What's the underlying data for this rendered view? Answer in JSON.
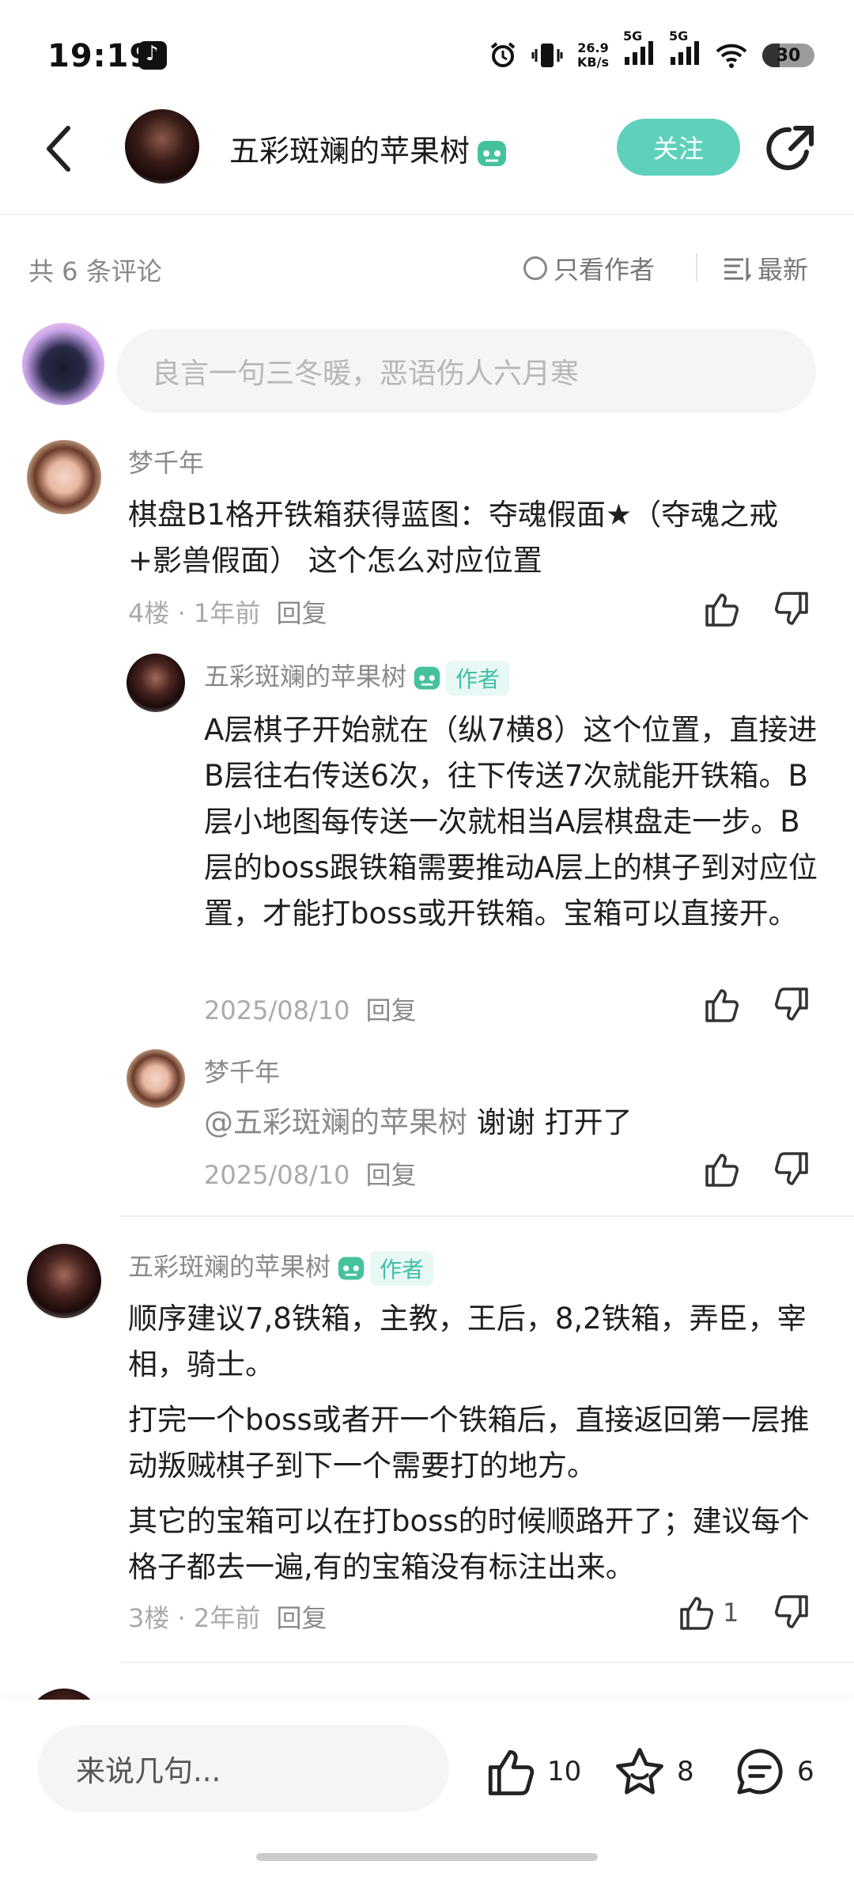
{
  "status_bar": {
    "time": "19:19",
    "net_speed_value": "26.9",
    "net_speed_unit": "KB/s",
    "signal1": "5G",
    "signal2": "5G",
    "battery": "30"
  },
  "header": {
    "username": "五彩斑斓的苹果树",
    "follow_label": "关注"
  },
  "filter": {
    "count_label": "共 6 条评论",
    "author_only_label": "只看作者",
    "sort_label": "最新"
  },
  "input": {
    "placeholder": "良言一句三冬暖，恶语伤人六月寒"
  },
  "comments": [
    {
      "user": "梦千年",
      "text": "棋盘B1格开铁箱获得蓝图：夺魂假面★（夺魂之戒+影兽假面） 这个怎么对应位置",
      "floor": "4楼",
      "time": "1年前",
      "reply_label": "回复",
      "replies": [
        {
          "user": "五彩斑斓的苹果树",
          "author_tag": "作者",
          "text": "A层棋子开始就在（纵7横8）这个位置，直接进B层往右传送6次，往下传送7次就能开铁箱。B层小地图每传送一次就相当A层棋盘走一步。B层的boss跟铁箱需要推动A层上的棋子到对应位置，才能打boss或开铁箱。宝箱可以直接开。",
          "date": "2025/08/10",
          "reply_label": "回复"
        },
        {
          "user": "梦千年",
          "mention": "@五彩斑斓的苹果树",
          "text": " 谢谢  打开了",
          "date": "2025/08/10",
          "reply_label": "回复"
        }
      ]
    },
    {
      "user": "五彩斑斓的苹果树",
      "author_tag": "作者",
      "paragraphs": [
        "顺序建议7,8铁箱，主教，王后，8,2铁箱，弄臣，宰相，骑士。",
        "打完一个boss或者开一个铁箱后，直接返回第一层推动叛贼棋子到下一个需要打的地方。",
        "其它的宝箱可以在打boss的时候顺路开了；建议每个格子都去一遍,有的宝箱没有标注出来。"
      ],
      "floor": "3楼",
      "time": "2年前",
      "reply_label": "回复",
      "likes": "1"
    }
  ],
  "bottom_bar": {
    "input_label": "来说几句...",
    "likes": "10",
    "favorites": "8",
    "comments": "6"
  },
  "colors": {
    "accent": "#5fd1bb",
    "author_tag_text": "#3fbfa5",
    "author_tag_bg": "#e8f8f4"
  }
}
